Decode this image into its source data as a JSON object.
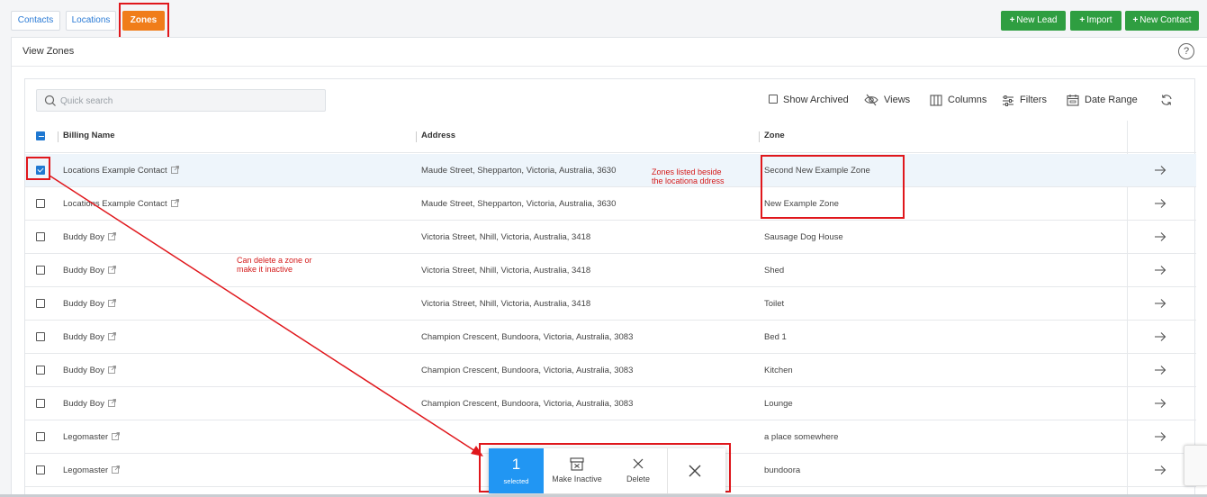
{
  "tabs": [
    {
      "label": "Contacts"
    },
    {
      "label": "Locations"
    },
    {
      "label": "Zones"
    }
  ],
  "actions": {
    "new_lead": "New Lead",
    "import": "Import",
    "new_contact": "New Contact",
    "plus": "+"
  },
  "page": {
    "title": "View Zones",
    "help": "?"
  },
  "toolbar": {
    "search_placeholder": "Quick search",
    "show_archived": "Show Archived",
    "views": "Views",
    "columns": "Columns",
    "filters": "Filters",
    "date_range": "Date Range"
  },
  "table": {
    "columns": [
      "Billing Name",
      "Address",
      "Zone"
    ],
    "rows": [
      {
        "name": "Locations Example Contact",
        "address": "Maude Street, Shepparton, Victoria, Australia, 3630",
        "zone": "Second New Example Zone",
        "checked": true
      },
      {
        "name": "Locations Example Contact",
        "address": "Maude Street, Shepparton, Victoria, Australia, 3630",
        "zone": "New Example Zone",
        "checked": false
      },
      {
        "name": "Buddy Boy",
        "address": "Victoria Street, Nhill, Victoria, Australia, 3418",
        "zone": "Sausage Dog House",
        "checked": false
      },
      {
        "name": "Buddy Boy",
        "address": "Victoria Street, Nhill, Victoria, Australia, 3418",
        "zone": "Shed",
        "checked": false
      },
      {
        "name": "Buddy Boy",
        "address": "Victoria Street, Nhill, Victoria, Australia, 3418",
        "zone": "Toilet",
        "checked": false
      },
      {
        "name": "Buddy Boy",
        "address": "Champion Crescent, Bundoora, Victoria, Australia, 3083",
        "zone": "Bed 1",
        "checked": false
      },
      {
        "name": "Buddy Boy",
        "address": "Champion Crescent, Bundoora, Victoria, Australia, 3083",
        "zone": "Kitchen",
        "checked": false
      },
      {
        "name": "Buddy Boy",
        "address": "Champion Crescent, Bundoora, Victoria, Australia, 3083",
        "zone": "Lounge",
        "checked": false
      },
      {
        "name": "Legomaster",
        "address": "",
        "zone": "a place somewhere",
        "checked": false
      },
      {
        "name": "Legomaster",
        "address": "",
        "zone": "bundoora",
        "checked": false
      }
    ]
  },
  "annotations": {
    "zones_line1": "Zones listed beside",
    "zones_line2": "the locationa ddress",
    "delete_line1": "Can delete a zone or",
    "delete_line2": "make it inactive"
  },
  "bulk": {
    "count": "1",
    "selected_label": "selected",
    "make_inactive": "Make Inactive",
    "delete": "Delete"
  },
  "colors": {
    "active_tab": "#f07d1a",
    "green_button": "#2f9e41",
    "primary_blue": "#2196f3",
    "annotation_red": "#e0171c"
  }
}
